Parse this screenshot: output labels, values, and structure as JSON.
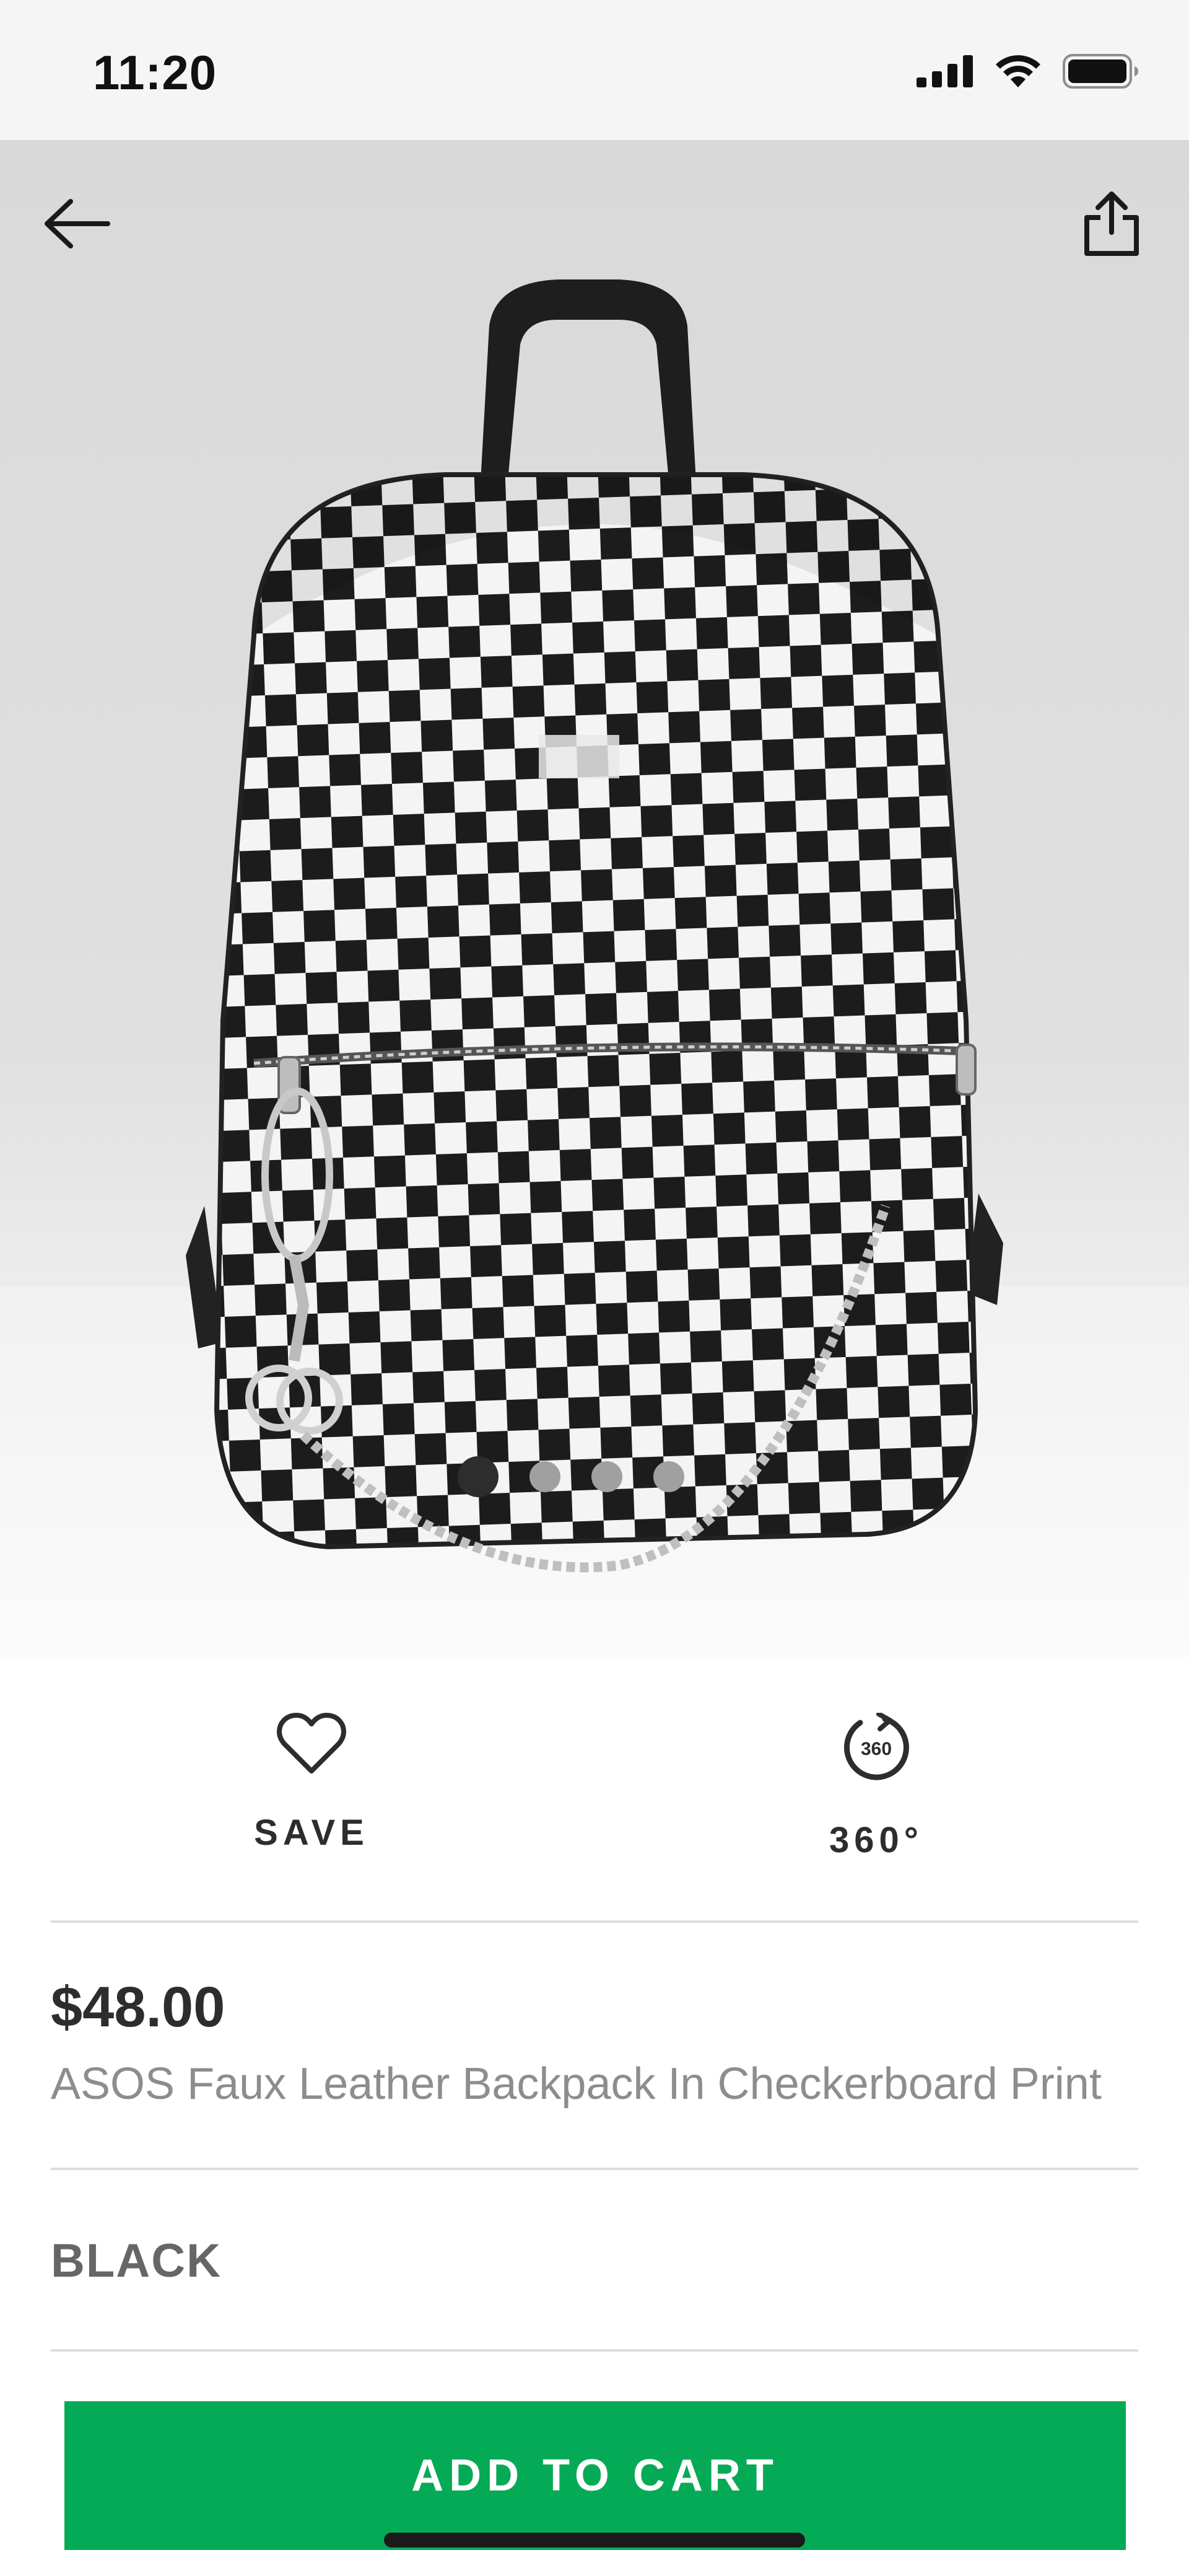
{
  "status_bar": {
    "time": "11:20",
    "icons": [
      "cellular-signal-icon",
      "wifi-icon",
      "battery-icon"
    ]
  },
  "hero": {
    "back_icon": "arrow-left-icon",
    "share_icon": "share-icon",
    "image": "checkerboard-backpack-photo",
    "pagination": {
      "total": 4,
      "active_index": 0
    }
  },
  "actions": {
    "save": {
      "label": "SAVE",
      "icon": "heart-icon"
    },
    "view360": {
      "label": "360°",
      "icon": "rotate-360-icon",
      "icon_text": "360"
    }
  },
  "product": {
    "price": "$48.00",
    "name": "ASOS Faux Leather Backpack In Checkerboard Print",
    "colour": "BLACK"
  },
  "cart": {
    "label": "ADD TO CART"
  },
  "colors": {
    "accent_green": "#05aa56",
    "text_dark": "#2d2d2d",
    "text_muted": "#8d8d8d",
    "divider": "#dddddd"
  }
}
